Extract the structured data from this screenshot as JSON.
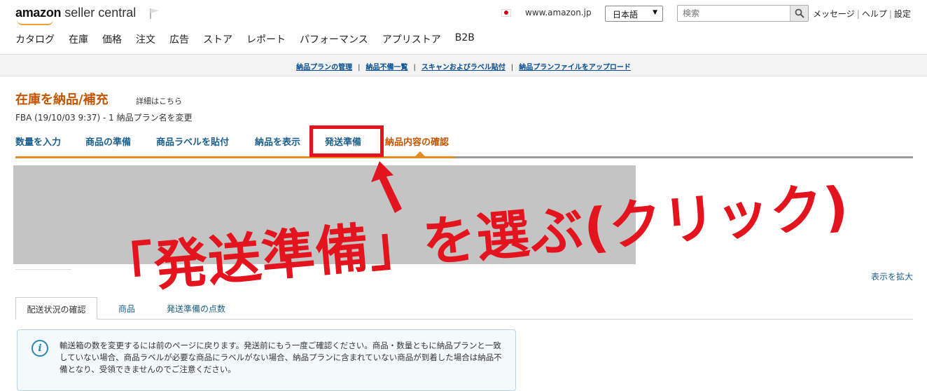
{
  "header": {
    "logo_bold": "amazon",
    "logo_light": " seller central",
    "domain": "www.amazon.jp",
    "language": "日本語",
    "search_placeholder": "検索",
    "links": [
      "メッセージ",
      "ヘルプ",
      "設定"
    ]
  },
  "main_nav": [
    "カタログ",
    "在庫",
    "価格",
    "注文",
    "広告",
    "ストア",
    "レポート",
    "パフォーマンス",
    "アプリストア",
    "B2B"
  ],
  "subbar": [
    "納品プランの管理",
    "納品不備一覧",
    "スキャンおよびラベル貼付",
    "納品プランファイルをアップロード"
  ],
  "page": {
    "title": "在庫を納品/補充",
    "detail_link": "詳細はこちら",
    "plan_line": "FBA (19/10/03 9:37) - 1  納品プラン名を変更"
  },
  "steps": [
    "数量を入力",
    "商品の準備",
    "商品ラベルを貼付",
    "納品を表示",
    "発送準備",
    "納品内容の確認"
  ],
  "expand_link": "表示を拡大",
  "tabs": [
    "配送状況の確認",
    "商品",
    "発送準備の点数"
  ],
  "info_text": "輸送箱の数を変更するには前のページに戻ります。発送前にもう一度ご確認ください。商品・数量ともに納品プランと一致していない場合、商品ラベルが必要な商品にラベルがない場合、納品プランに含まれていない商品が到着した場合は納品不備となり、受領できませんのでご注意ください。",
  "annotation": "「発送準備」を選ぶ(クリック)",
  "colors": {
    "accent_orange": "#c45500",
    "link_blue": "#1a5e8a",
    "annotation_red": "#e3141e"
  }
}
